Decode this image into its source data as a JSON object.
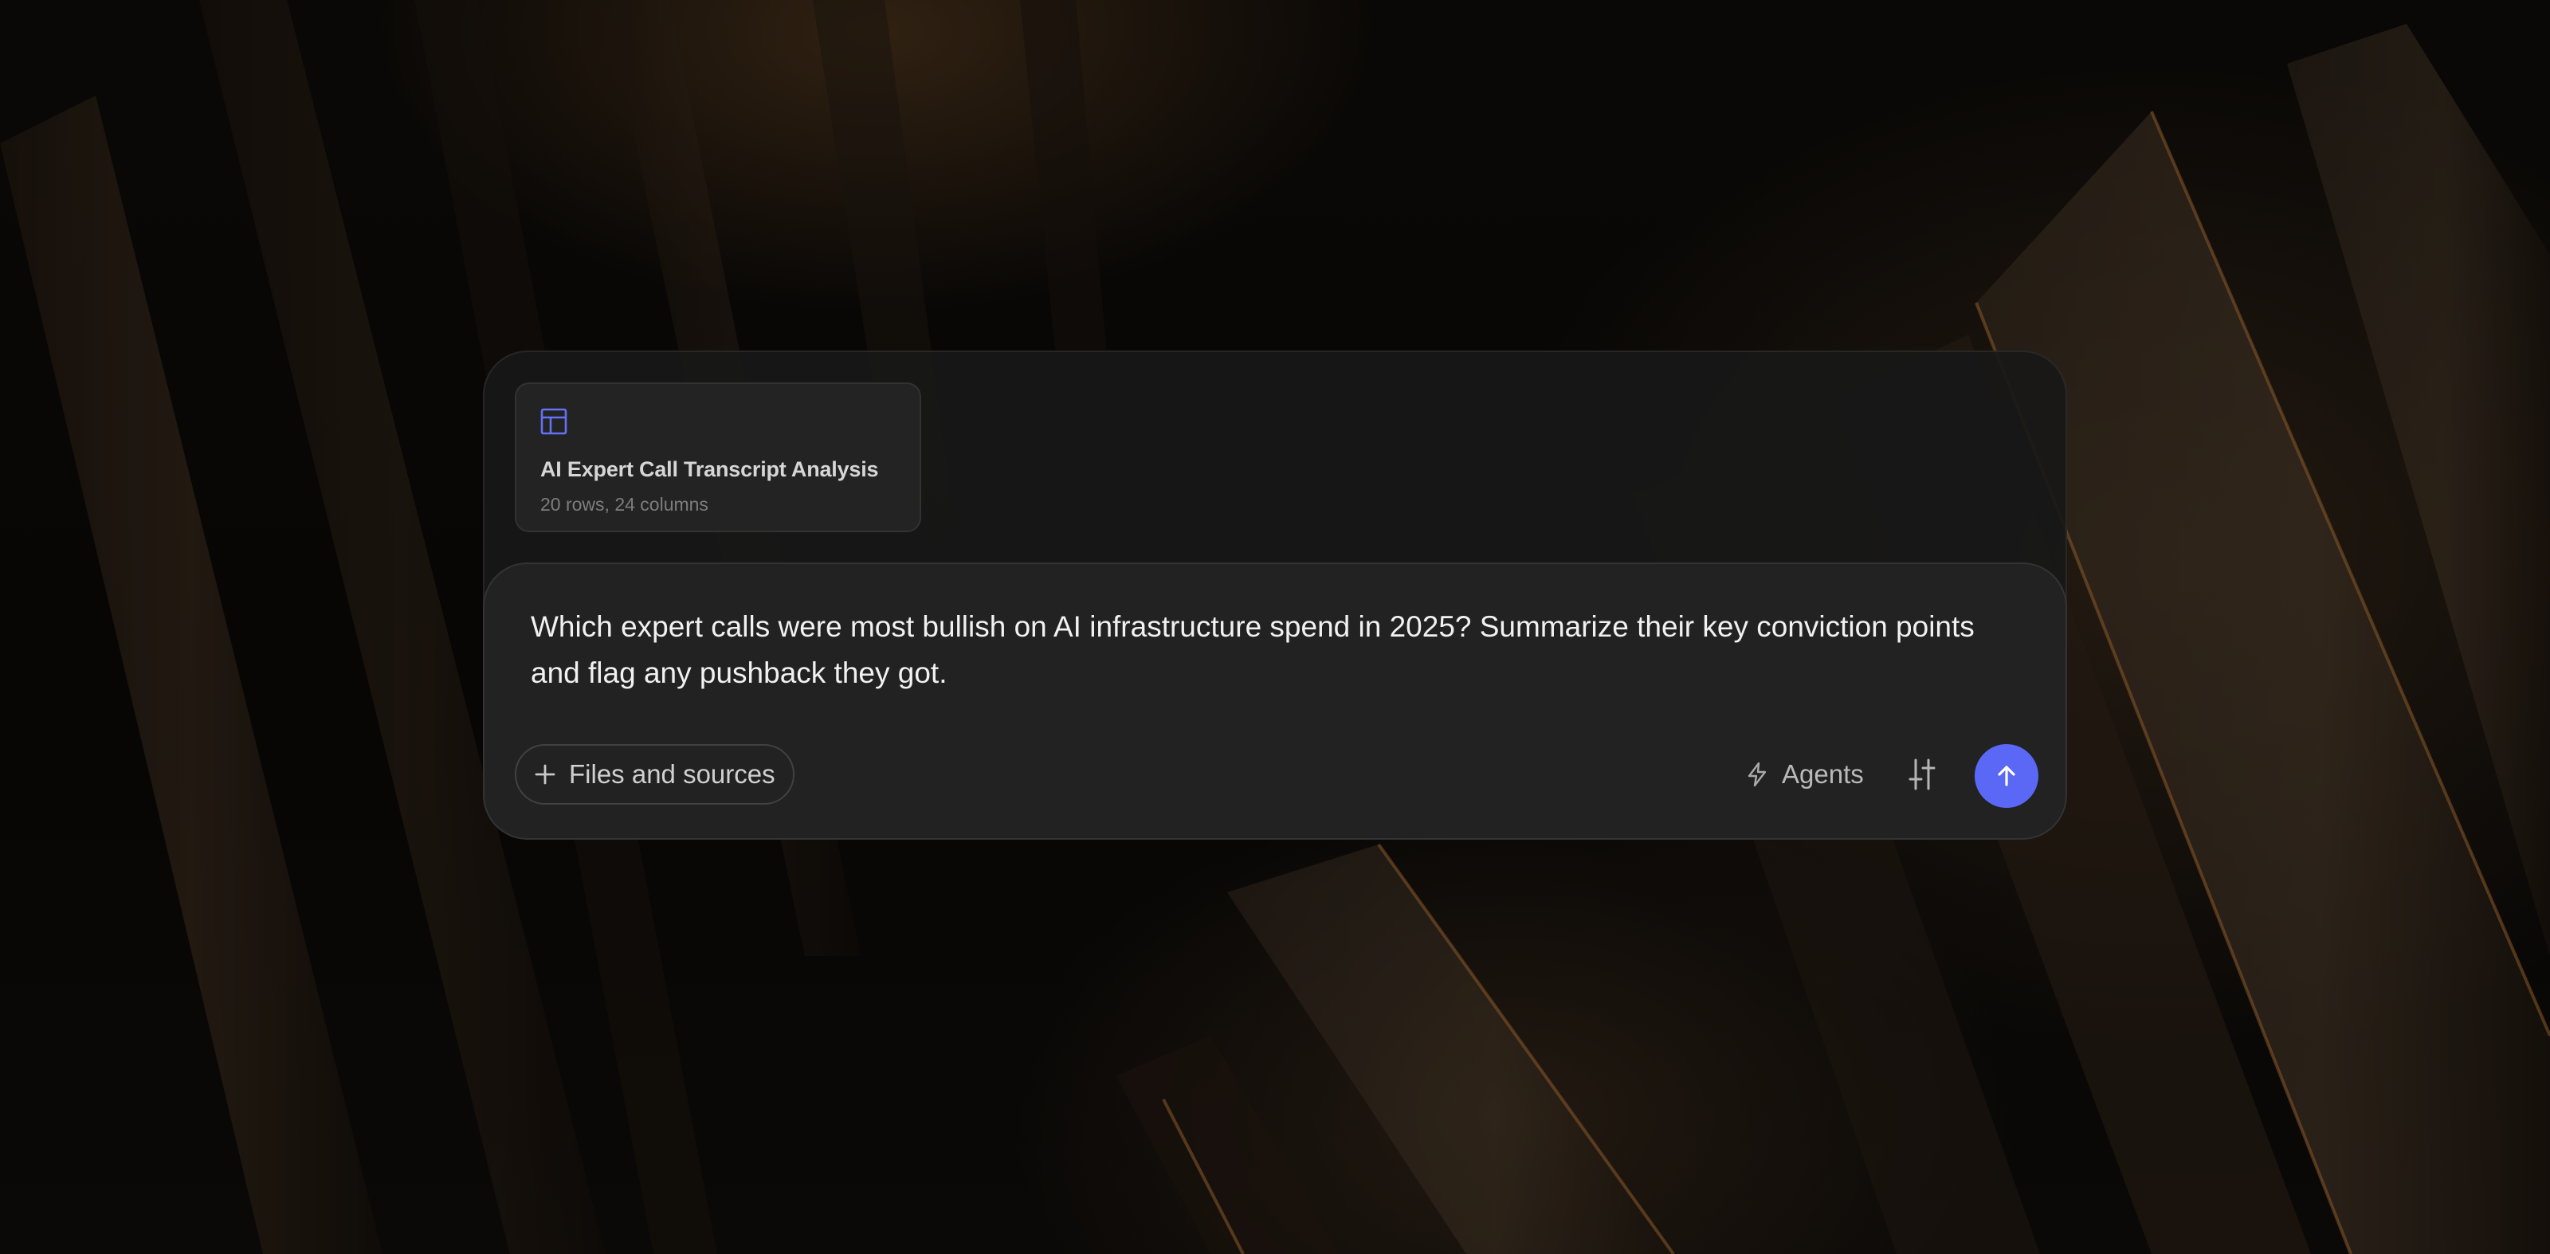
{
  "attachment": {
    "icon": "table-icon",
    "title": "AI Expert Call Transcript Analysis",
    "meta": "20 rows, 24 columns"
  },
  "composer": {
    "prompt_text": "Which expert calls were most bullish on AI infrastructure spend in 2025? Summarize their key conviction points and flag any pushback they got.",
    "files_button_label": "Files and sources",
    "files_button_icon": "plus-icon",
    "agents_label": "Agents",
    "agents_icon": "lightning-icon",
    "settings_icon": "sliders-icon",
    "send_icon": "arrow-up-icon"
  },
  "colors": {
    "accent": "#5b68f5",
    "panel": "#222222",
    "card": "#232323"
  }
}
